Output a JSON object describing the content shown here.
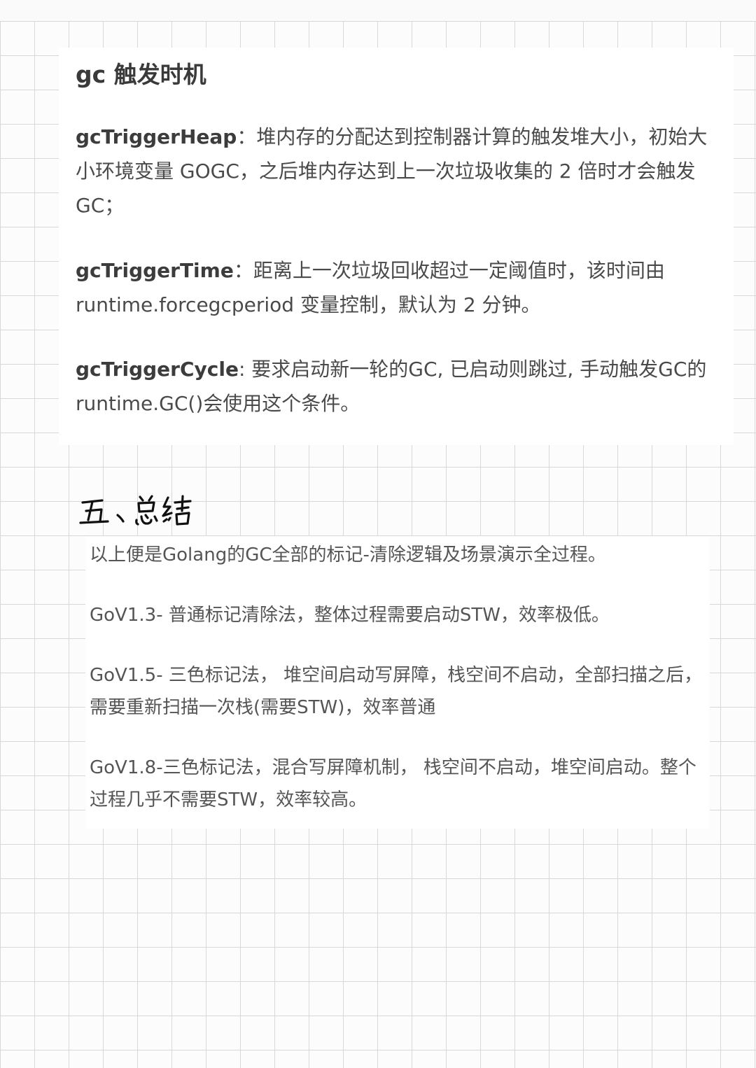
{
  "section_gc_trigger": {
    "title": "gc 触发时机",
    "items": [
      {
        "term": "gcTriggerHeap",
        "separator": "：",
        "text": "堆内存的分配达到控制器计算的触发堆大小，初始大小环境变量 GOGC，之后堆内存达到上一次垃圾收集的 2 倍时才会触发 GC；"
      },
      {
        "term": "gcTriggerTime",
        "separator": "：",
        "text": "距离上一次垃圾回收超过一定阈值时，该时间由 runtime.forcegcperiod 变量控制，默认为 2 分钟。"
      },
      {
        "term": "gcTriggerCycle",
        "separator": ": ",
        "text": "要求启动新一轮的GC, 已启动则跳过, 手动触发GC的runtime.GC()会使用这个条件。"
      }
    ]
  },
  "section_summary": {
    "handwritten_heading": "五、总结",
    "lines": [
      "以上便是Golang的GC全部的标记-清除逻辑及场景演示全过程。",
      "GoV1.3- 普通标记清除法，整体过程需要启动STW，效率极低。",
      "GoV1.5- 三色标记法， 堆空间启动写屏障，栈空间不启动，全部扫描之后，需要重新扫描一次栈(需要STW)，效率普通",
      "GoV1.8-三色标记法，混合写屏障机制， 栈空间不启动，堆空间启动。整个过程几乎不需要STW，效率较高。"
    ]
  }
}
